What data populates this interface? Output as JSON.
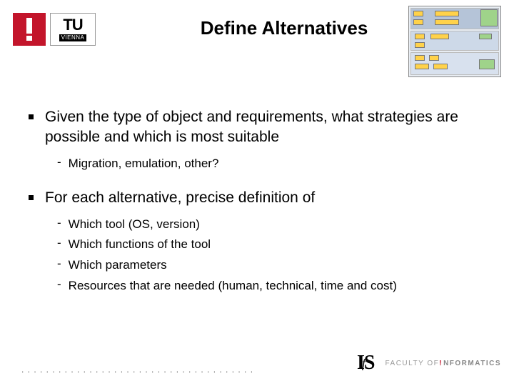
{
  "logo": {
    "tu_top": "TU",
    "tu_bottom": "VIENNA"
  },
  "title": "Define Alternatives",
  "bullets": [
    {
      "text": "Given the type of object and requirements, what strategies are possible and which is most suitable",
      "sub": [
        "Migration, emulation, other?"
      ]
    },
    {
      "text": "For each alternative, precise definition of",
      "sub": [
        "Which tool (OS, version)",
        "Which functions of the tool",
        "Which parameters",
        "Resources that are needed (human, technical, time and cost)"
      ]
    }
  ],
  "footer": {
    "dots": ". . . . . . . . . . . . . . . . . . . . . . . . . . . . . . . . . . . . . .",
    "ifs_i": "I",
    "ifs_f": "f",
    "ifs_s": "S",
    "faculty_prefix": "FACULTY OF ",
    "faculty_bang": "!",
    "faculty_word": "NFORMATICS"
  }
}
